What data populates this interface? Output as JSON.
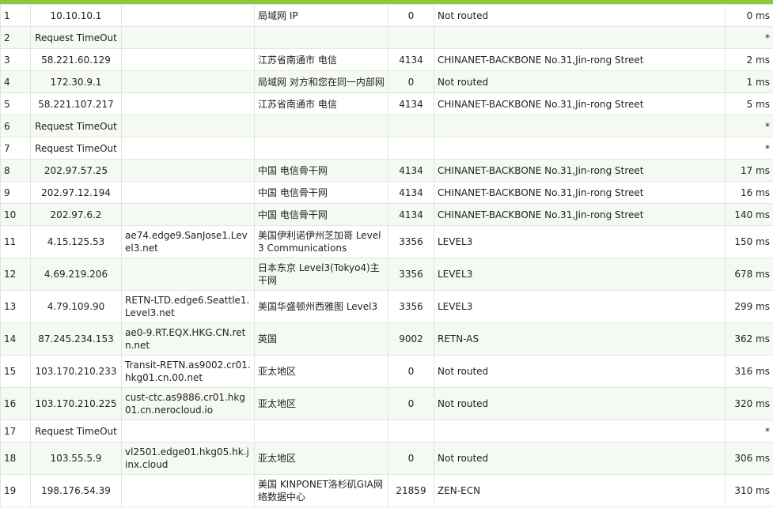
{
  "hops": [
    {
      "no": "1",
      "ip": "10.10.10.1",
      "host": "",
      "location": "局域网 IP",
      "asn": "0",
      "org": "Not routed",
      "time": "0 ms"
    },
    {
      "no": "2",
      "ip": "Request TimeOut",
      "host": "",
      "location": "",
      "asn": "",
      "org": "",
      "time": "*"
    },
    {
      "no": "3",
      "ip": "58.221.60.129",
      "host": "",
      "location": "江苏省南通市 电信",
      "asn": "4134",
      "org": "CHINANET-BACKBONE No.31,Jin-rong Street",
      "time": "2 ms"
    },
    {
      "no": "4",
      "ip": "172.30.9.1",
      "host": "",
      "location": "局域网 对方和您在同一内部网",
      "asn": "0",
      "org": "Not routed",
      "time": "1 ms"
    },
    {
      "no": "5",
      "ip": "58.221.107.217",
      "host": "",
      "location": "江苏省南通市 电信",
      "asn": "4134",
      "org": "CHINANET-BACKBONE No.31,Jin-rong Street",
      "time": "5 ms"
    },
    {
      "no": "6",
      "ip": "Request TimeOut",
      "host": "",
      "location": "",
      "asn": "",
      "org": "",
      "time": "*"
    },
    {
      "no": "7",
      "ip": "Request TimeOut",
      "host": "",
      "location": "",
      "asn": "",
      "org": "",
      "time": "*"
    },
    {
      "no": "8",
      "ip": "202.97.57.25",
      "host": "",
      "location": "中国 电信骨干网",
      "asn": "4134",
      "org": "CHINANET-BACKBONE No.31,Jin-rong Street",
      "time": "17 ms"
    },
    {
      "no": "9",
      "ip": "202.97.12.194",
      "host": "",
      "location": "中国 电信骨干网",
      "asn": "4134",
      "org": "CHINANET-BACKBONE No.31,Jin-rong Street",
      "time": "16 ms"
    },
    {
      "no": "10",
      "ip": "202.97.6.2",
      "host": "",
      "location": "中国 电信骨干网",
      "asn": "4134",
      "org": "CHINANET-BACKBONE No.31,Jin-rong Street",
      "time": "140 ms"
    },
    {
      "no": "11",
      "ip": "4.15.125.53",
      "host": "ae74.edge9.SanJose1.Level3.net",
      "location": "美国伊利诺伊州芝加哥 Level3 Communications",
      "asn": "3356",
      "org": "LEVEL3",
      "time": "150 ms"
    },
    {
      "no": "12",
      "ip": "4.69.219.206",
      "host": "",
      "location": "日本东京 Level3(Tokyo4)主干网",
      "asn": "3356",
      "org": "LEVEL3",
      "time": "678 ms"
    },
    {
      "no": "13",
      "ip": "4.79.109.90",
      "host": "RETN-LTD.edge6.Seattle1.Level3.net",
      "location": "美国华盛顿州西雅图 Level3",
      "asn": "3356",
      "org": "LEVEL3",
      "time": "299 ms"
    },
    {
      "no": "14",
      "ip": "87.245.234.153",
      "host": "ae0-9.RT.EQX.HKG.CN.retn.net",
      "location": "英国",
      "asn": "9002",
      "org": "RETN-AS",
      "time": "362 ms"
    },
    {
      "no": "15",
      "ip": "103.170.210.233",
      "host": "Transit-RETN.as9002.cr01.hkg01.cn.00.net",
      "location": "亚太地区",
      "asn": "0",
      "org": "Not routed",
      "time": "316 ms"
    },
    {
      "no": "16",
      "ip": "103.170.210.225",
      "host": "cust-ctc.as9886.cr01.hkg01.cn.nerocloud.io",
      "location": "亚太地区",
      "asn": "0",
      "org": "Not routed",
      "time": "320 ms"
    },
    {
      "no": "17",
      "ip": "Request TimeOut",
      "host": "",
      "location": "",
      "asn": "",
      "org": "",
      "time": "*"
    },
    {
      "no": "18",
      "ip": "103.55.5.9",
      "host": "vl2501.edge01.hkg05.hk.jinx.cloud",
      "location": "亚太地区",
      "asn": "0",
      "org": "Not routed",
      "time": "306 ms"
    },
    {
      "no": "19",
      "ip": "198.176.54.39",
      "host": "",
      "location": "美国 KINPONET洛杉矶GIA网络数据中心",
      "asn": "21859",
      "org": "ZEN-ECN",
      "time": "310 ms"
    }
  ]
}
